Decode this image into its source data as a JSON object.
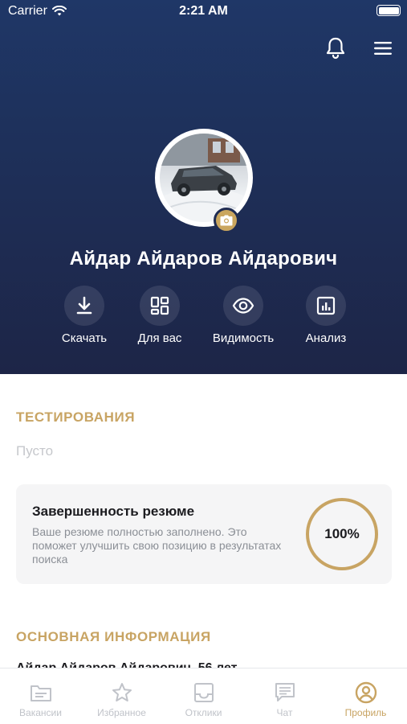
{
  "status_bar": {
    "carrier": "Carrier",
    "time": "2:21 AM"
  },
  "header": {
    "user_name": "Айдар Айдаров Айдарович",
    "actions": [
      {
        "label": "Скачать",
        "icon": "download-icon"
      },
      {
        "label": "Для вас",
        "icon": "grid-icon"
      },
      {
        "label": "Видимость",
        "icon": "eye-icon"
      },
      {
        "label": "Анализ",
        "icon": "analytics-icon"
      }
    ]
  },
  "testing": {
    "title": "ТЕСТИРОВАНИЯ",
    "empty_text": "Пусто"
  },
  "completeness": {
    "title": "Завершенность резюме",
    "description": "Ваше резюме полностью заполнено. Это поможет улучшить свою позицию в результатах поиска",
    "percent_label": "100%",
    "percent_value": 100
  },
  "basic_info": {
    "title": "ОСНОВНАЯ ИНФОРМАЦИЯ",
    "partial_text": "Айдар Айдаров Айдарович, 56 лет"
  },
  "tabbar": {
    "tabs": [
      {
        "label": "Вакансии",
        "icon": "document-icon",
        "active": false
      },
      {
        "label": "Избранное",
        "icon": "star-icon",
        "active": false
      },
      {
        "label": "Отклики",
        "icon": "inbox-icon",
        "active": false
      },
      {
        "label": "Чат",
        "icon": "chat-icon",
        "active": false
      },
      {
        "label": "Профиль",
        "icon": "profile-icon",
        "active": true
      }
    ]
  },
  "colors": {
    "header_bg": "#1e2f58",
    "accent": "#c8a463",
    "inactive": "#c0c3c9"
  }
}
